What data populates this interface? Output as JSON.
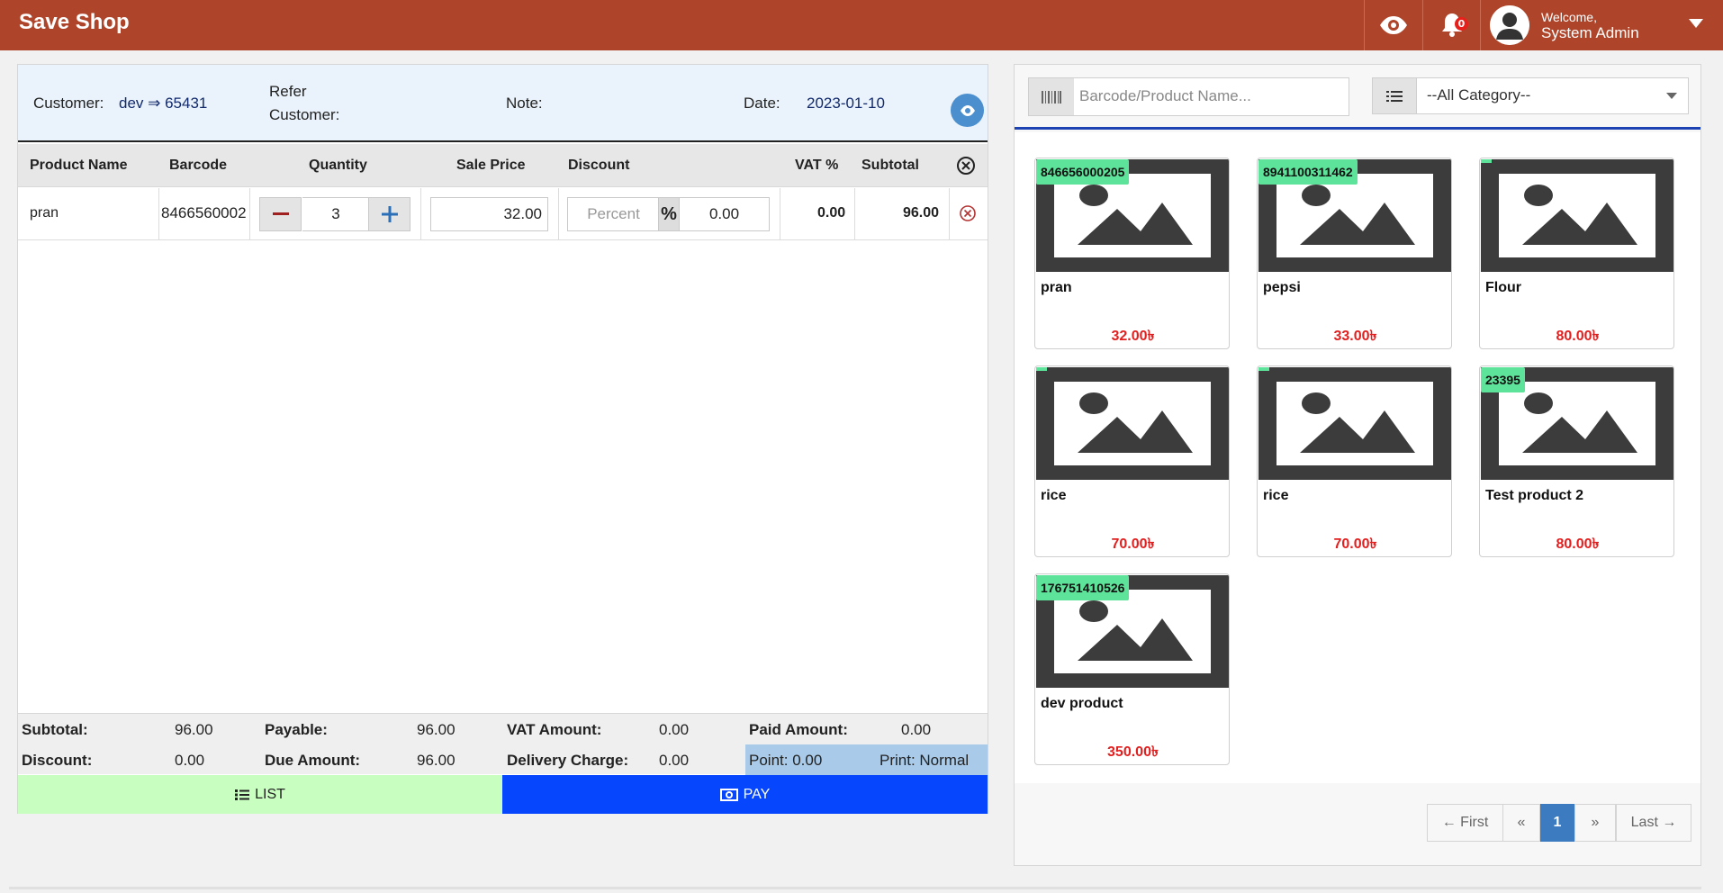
{
  "header": {
    "brand": "Save Shop",
    "notification_count": "0",
    "welcome_label": "Welcome,",
    "user_name": "System Admin"
  },
  "customer_bar": {
    "customer_label": "Customer:",
    "customer_value": "dev ⇒ 65431",
    "refer_label_line1": "Refer",
    "refer_label_line2": "Customer:",
    "note_label": "Note:",
    "date_label": "Date:",
    "date_value": "2023-01-10"
  },
  "table": {
    "headers": [
      "Product Name",
      "Barcode",
      "Quantity",
      "Sale Price",
      "Discount",
      "VAT %",
      "Subtotal"
    ],
    "rows": [
      {
        "product_name": "pran",
        "barcode": "8466560002",
        "quantity": "3",
        "sale_price": "32.00",
        "discount_type_placeholder": "Percent",
        "discount_symbol": "%",
        "discount_value": "0.00",
        "vat": "0.00",
        "subtotal": "96.00"
      }
    ]
  },
  "summary": {
    "subtotal_label": "Subtotal:",
    "subtotal_value": "96.00",
    "payable_label": "Payable:",
    "payable_value": "96.00",
    "vat_amount_label": "VAT Amount:",
    "vat_amount_value": "0.00",
    "paid_amount_label": "Paid Amount:",
    "paid_amount_value": "0.00",
    "discount_label": "Discount:",
    "discount_value": "0.00",
    "due_amount_label": "Due Amount:",
    "due_amount_value": "96.00",
    "delivery_charge_label": "Delivery Charge:",
    "delivery_charge_value": "0.00",
    "point_text": "Point: 0.00",
    "print_text": "Print: Normal"
  },
  "actions": {
    "list_label": "LIST",
    "pay_label": "PAY"
  },
  "search": {
    "placeholder": "Barcode/Product Name...",
    "category_selected": "--All Category--"
  },
  "products": [
    {
      "badge": "846656000205",
      "name": "pran",
      "price": "32.00৳"
    },
    {
      "badge": "8941100311462",
      "name": "pepsi",
      "price": "33.00৳"
    },
    {
      "badge": "",
      "name": "Flour",
      "price": "80.00৳"
    },
    {
      "badge": "",
      "name": "rice",
      "price": "70.00৳"
    },
    {
      "badge": "",
      "name": "rice",
      "price": "70.00৳"
    },
    {
      "badge": "23395",
      "name": "Test product 2",
      "price": "80.00৳"
    },
    {
      "badge": "176751410526",
      "name": "dev product",
      "price": "350.00৳"
    }
  ],
  "pagination": {
    "first": "← First",
    "prev": "«",
    "current": "1",
    "next": "»",
    "last": "Last →"
  },
  "colors": {
    "header_bg": "#ae4429",
    "pay_bg": "#0646fd",
    "list_bg": "#c8fec0",
    "price_red": "#e21f1f",
    "badge_green": "#5de39a",
    "active_page": "#3c7bbf"
  }
}
